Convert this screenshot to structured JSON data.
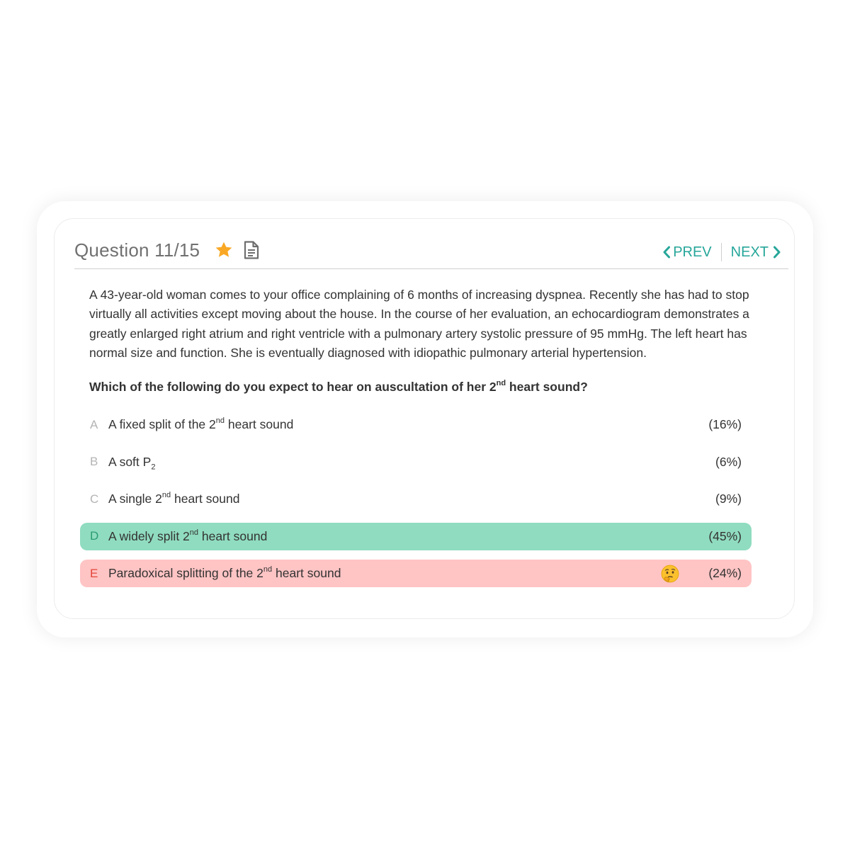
{
  "header": {
    "question_label": "Question 11/15",
    "prev_label": "PREV",
    "next_label": "NEXT",
    "star_icon": "star-icon",
    "notes_icon": "document-icon"
  },
  "stem": "A 43-year-old woman comes to your office complaining of 6 months of increasing dyspnea. Recently she has had to stop virtually all activities except moving about the house. In the course of her evaluation, an echocardiogram demonstrates a greatly enlarged right atrium and right ventricle with a pulmonary artery systolic pressure of 95 mmHg. The left heart has normal size and function. She is eventually diagnosed with idiopathic pulmonary arterial hypertension.",
  "question": {
    "before": "Which of the following do you expect to hear on auscultation of her 2",
    "sup": "nd",
    "after": " heart sound?"
  },
  "answers": [
    {
      "letter": "A",
      "before": "A fixed split of the 2",
      "sup": "nd",
      "after": " heart sound",
      "pct": "(16%)",
      "state": "none"
    },
    {
      "letter": "B",
      "before": "A soft P",
      "sub": "2",
      "after": "",
      "pct": "(6%)",
      "state": "none"
    },
    {
      "letter": "C",
      "before": "A single 2",
      "sup": "nd",
      "after": " heart sound",
      "pct": "(9%)",
      "state": "none"
    },
    {
      "letter": "D",
      "before": "A widely split 2",
      "sup": "nd",
      "after": " heart sound",
      "pct": "(45%)",
      "state": "correct"
    },
    {
      "letter": "E",
      "before": "Paradoxical splitting of the 2",
      "sup": "nd",
      "after": " heart sound",
      "pct": "(24%)",
      "state": "wrong",
      "icon": "thinking-face-icon"
    }
  ],
  "colors": {
    "accent": "#26a69a",
    "star": "#f9a825",
    "correct_bg": "#90dcc0",
    "wrong_bg": "#ffc4c4"
  }
}
